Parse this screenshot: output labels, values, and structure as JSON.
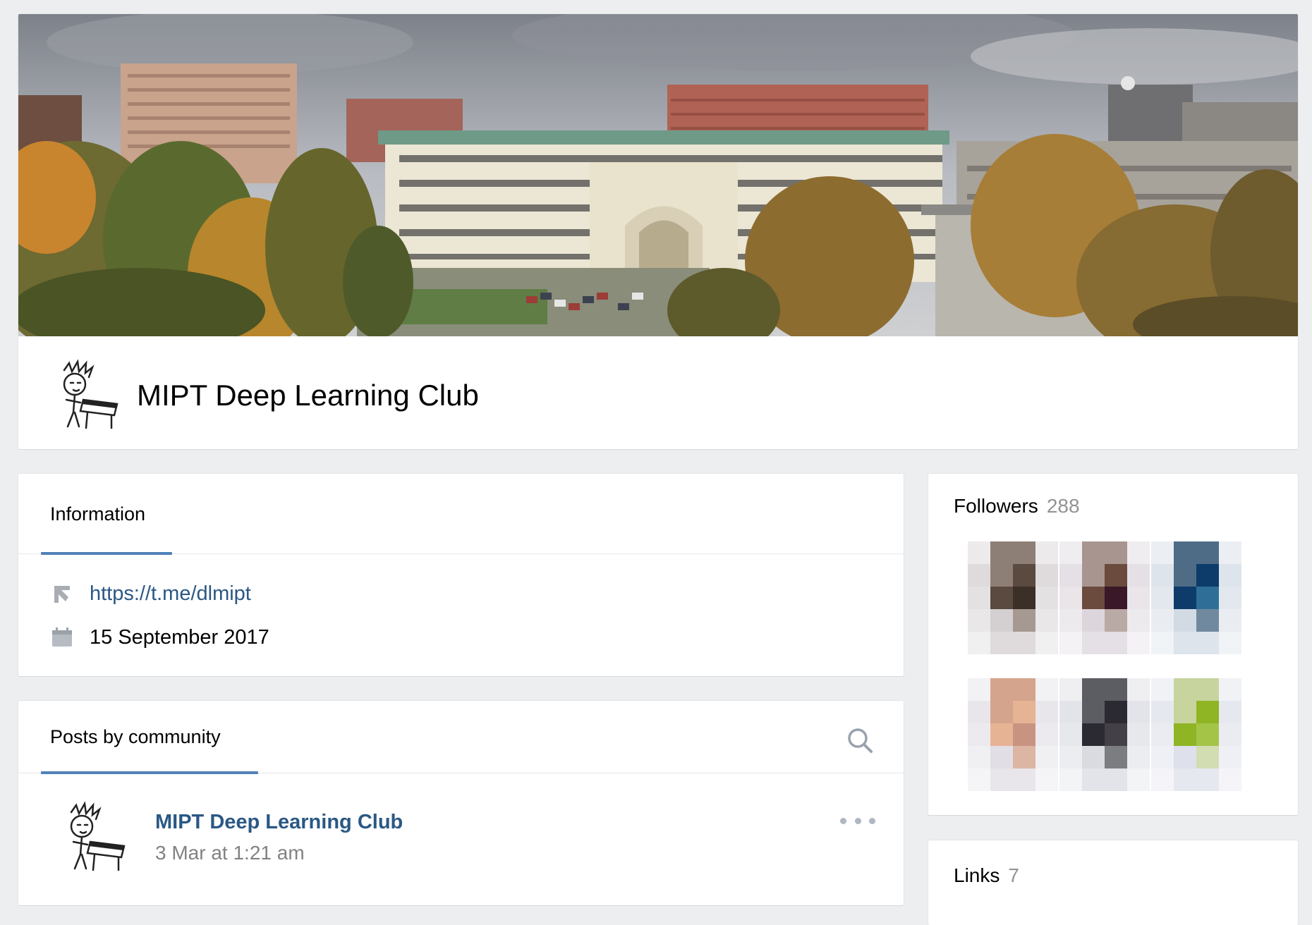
{
  "group": {
    "name": "MIPT Deep Learning Club"
  },
  "info": {
    "tab_label": "Information",
    "link": "https://t.me/dlmipt",
    "date": "15 September 2017"
  },
  "posts": {
    "tab_label": "Posts by community",
    "post": {
      "author": "MIPT Deep Learning Club",
      "date": "3 Mar at 1:21 am"
    }
  },
  "followers": {
    "title": "Followers",
    "count": "288",
    "avatars": [
      {
        "colors": [
          "#8e7f76",
          "#5b4a40",
          "#3b3028",
          "#c9c3c6"
        ]
      },
      {
        "colors": [
          "#a89590",
          "#6b4b3e",
          "#3a1827",
          "#d3cbd3"
        ]
      },
      {
        "colors": [
          "#4e6c86",
          "#0d3c6b",
          "#2f6f97",
          "#c7d2dd"
        ]
      },
      {
        "colors": [
          "#d4a48c",
          "#e6b394",
          "#c99382",
          "#d9d6de"
        ]
      },
      {
        "colors": [
          "#5b5d62",
          "#2b2a33",
          "#444048",
          "#d0d2da"
        ]
      },
      {
        "colors": [
          "#c7d49d",
          "#8fb524",
          "#a4c448",
          "#d6d9e6"
        ]
      }
    ]
  },
  "links": {
    "title": "Links",
    "count": "7"
  },
  "colors": {
    "accent": "#5181b8",
    "link": "#2a5885",
    "background": "#edeef0"
  },
  "icons": {
    "link_icon": "link-arrow-icon",
    "date_icon": "calendar-icon",
    "search_icon": "search-icon",
    "more_icon": "more-dots-icon"
  }
}
